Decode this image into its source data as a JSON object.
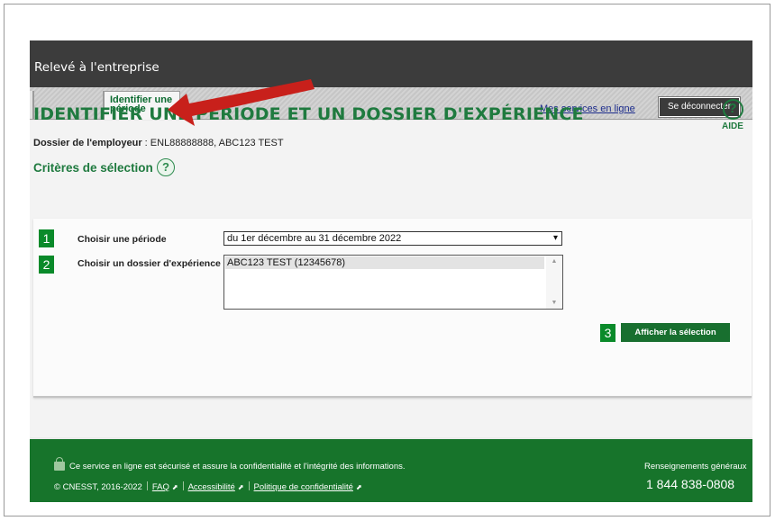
{
  "app": {
    "title": "Relevé à l'entreprise"
  },
  "tabs": [
    {
      "label": "Identifier une période",
      "active": true
    }
  ],
  "header_links": {
    "services": "Mes services en ligne",
    "logout": "Se déconnecter"
  },
  "page": {
    "title": "IDENTIFIER UNE PÉRIODE ET UN DOSSIER D'EXPÉRIENCE",
    "help_label": "AIDE",
    "help_icon": "question-circle-icon",
    "employer_label": "Dossier de l'employeur",
    "employer_value": ": ENL88888888, ABC123 TEST"
  },
  "criteria": {
    "title": "Critères de sélection",
    "help_icon": "question-circle-icon",
    "period_label": "Choisir une période",
    "period_value": "du 1er décembre au 31 décembre 2022",
    "dossier_label": "Choisir un dossier d'expérience",
    "dossier_options": [
      "ABC123 TEST (12345678)"
    ],
    "submit_label": "Afficher la sélection"
  },
  "annotations": {
    "badges": [
      "1",
      "2",
      "3"
    ],
    "badge_color": "#0a8a2a",
    "arrow_color": "#c8201b"
  },
  "footer": {
    "secure_text": "Ce service en ligne est sécurisé et assure la confidentialité et l'intégrité des informations.",
    "copyright": "© CNESST, 2016-2022",
    "links": [
      "FAQ",
      "Accessibilité",
      "Politique de confidentialité"
    ],
    "info_title": "Renseignements généraux",
    "phone": "1 844 838-0808"
  },
  "colors": {
    "brand_green": "#1f7a3f",
    "footer_green": "#17742b",
    "header_dark": "#3c3c3c"
  }
}
